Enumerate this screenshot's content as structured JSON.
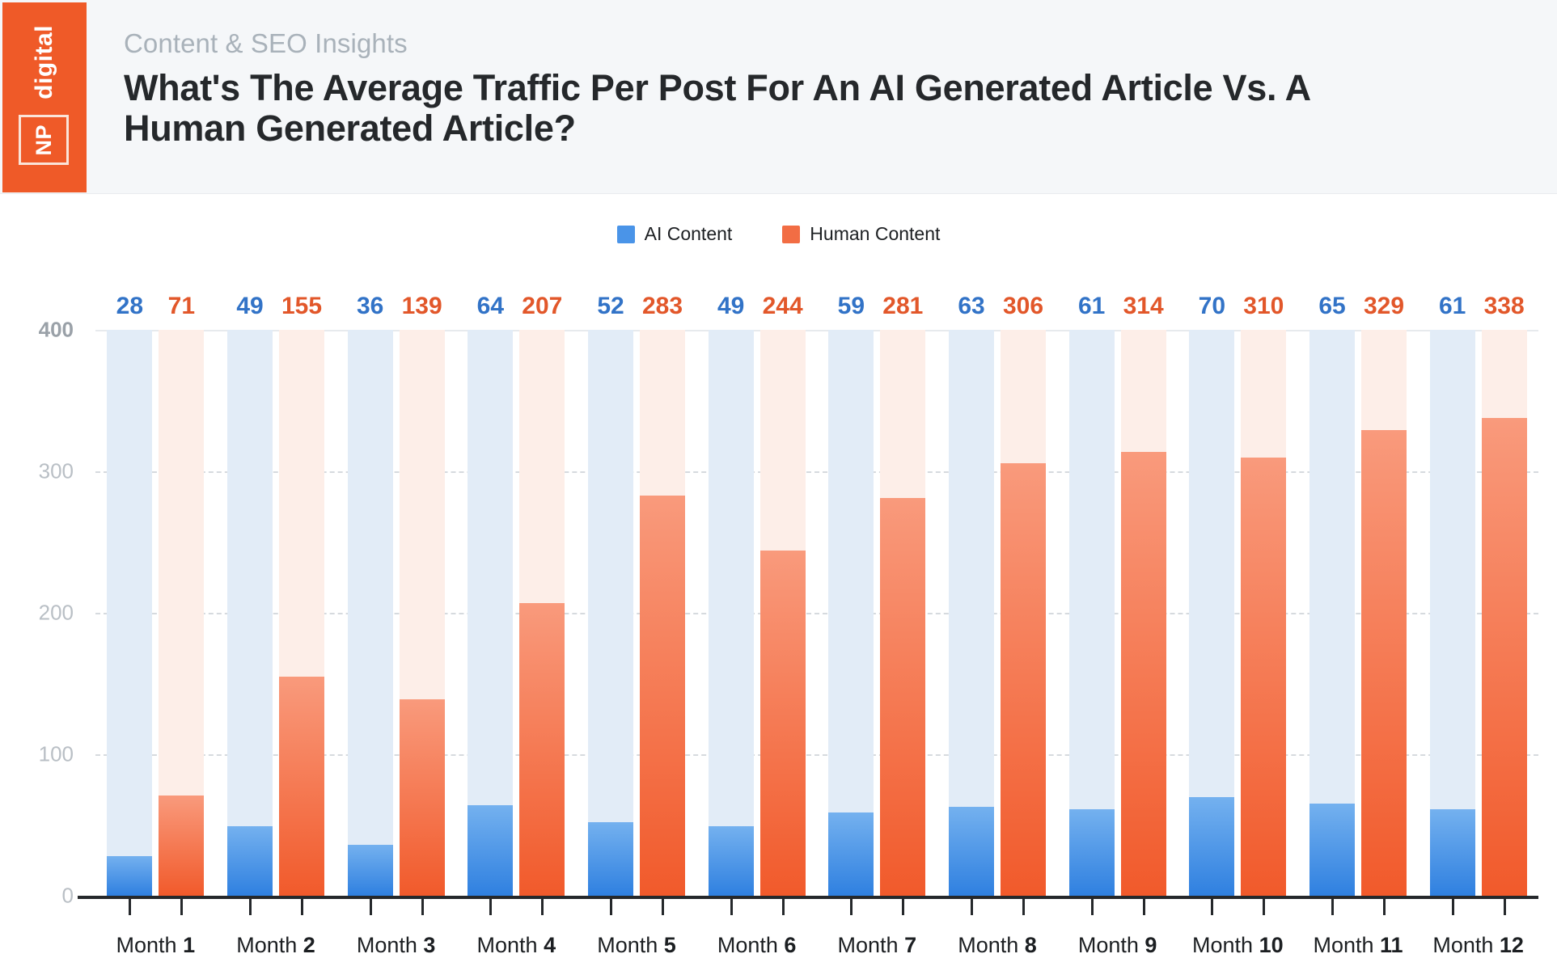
{
  "header": {
    "eyebrow": "Content & SEO Insights",
    "headline": "What's The Average Traffic Per Post For An AI Generated Article Vs. A Human Generated Article?",
    "logo": {
      "word": "digital",
      "mark": "NP",
      "brand_color": "#ef5a28"
    }
  },
  "legend": {
    "items": [
      {
        "label": "AI Content",
        "color": "#4a94e8"
      },
      {
        "label": "Human Content",
        "color": "#f26d44"
      }
    ]
  },
  "chart_data": {
    "type": "bar",
    "title": "What's The Average Traffic Per Post For An AI Generated Article Vs. A Human Generated Article?",
    "subtitle": "Content & SEO Insights",
    "xlabel": "",
    "ylabel": "",
    "ylim": [
      0,
      400
    ],
    "yticks": [
      0,
      100,
      200,
      300,
      400
    ],
    "ytick_labels": [
      "0",
      "100",
      "200",
      "300",
      "400"
    ],
    "grid": true,
    "legend_position": "top-center",
    "categories": [
      "Month 1",
      "Month 2",
      "Month 3",
      "Month 4",
      "Month 5",
      "Month 6",
      "Month 7",
      "Month 8",
      "Month 9",
      "Month 10",
      "Month 11",
      "Month 12"
    ],
    "series": [
      {
        "name": "AI Content",
        "color": "#3273c7",
        "values": [
          28,
          49,
          36,
          64,
          52,
          49,
          59,
          63,
          61,
          70,
          65,
          61
        ]
      },
      {
        "name": "Human Content",
        "color": "#e2572a",
        "values": [
          71,
          155,
          139,
          207,
          283,
          244,
          281,
          306,
          314,
          310,
          329,
          338
        ]
      }
    ]
  }
}
